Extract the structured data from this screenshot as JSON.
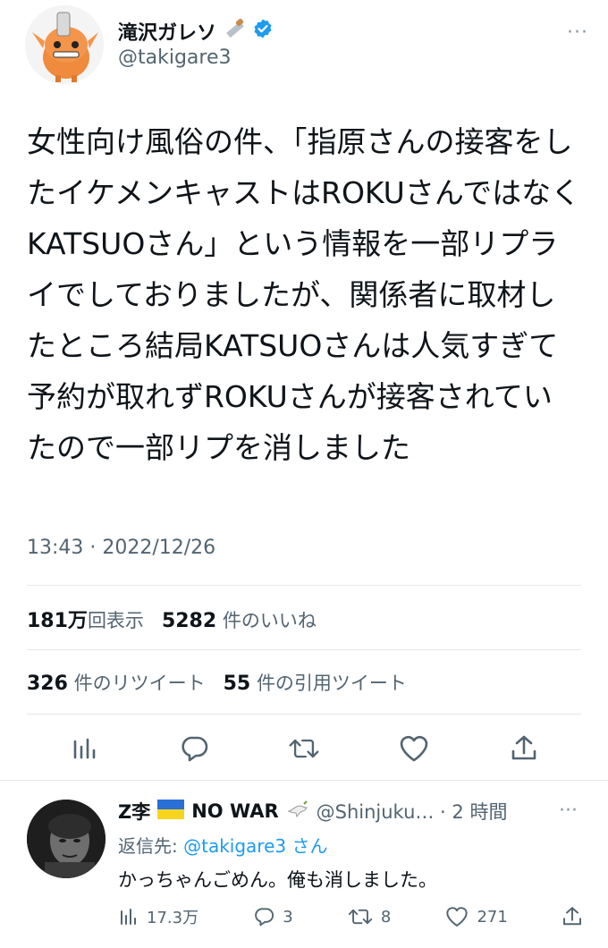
{
  "tweet": {
    "display_name": "滝沢ガレソ",
    "handle": "@takigare3",
    "more": "···",
    "text": "女性向け風俗の件、「指原さんの接客をしたイケメンキャストはROKUさんではなくKATSUOさん」という情報を一部リプライでしておりましたが、関係者に取材したところ結局KATSUOさんは人気すぎて予約が取れずROKUさんが接客されていたので一部リプを消しました",
    "timestamp": "13:43 · 2022/12/26",
    "views_count": "181万",
    "views_label": "回表示",
    "likes_count": "5282",
    "likes_label": "件のいいね",
    "retweets_count": "326",
    "retweets_label": "件のリツイート",
    "quotes_count": "55",
    "quotes_label": "件の引用ツイート"
  },
  "actions": [
    "analytics-icon",
    "reply-icon",
    "retweet-icon",
    "like-icon",
    "share-icon"
  ],
  "reply": {
    "display_name": "Z李",
    "flag": "ukraine-flag",
    "no_war": "NO WAR",
    "handle_time": "@Shinjuku… · 2 時間",
    "more": "···",
    "reply_to_prefix": "返信先: ",
    "reply_to_mention": "@takigare3",
    "reply_to_suffix": " さん",
    "text": "かっちゃんごめん。俺も消しました。",
    "views": "17.3万",
    "replies": "3",
    "retweets": "8",
    "likes": "271"
  },
  "colors": {
    "verified": "#1d9bf0",
    "link": "#1d9bf0",
    "secondary": "#536471"
  }
}
